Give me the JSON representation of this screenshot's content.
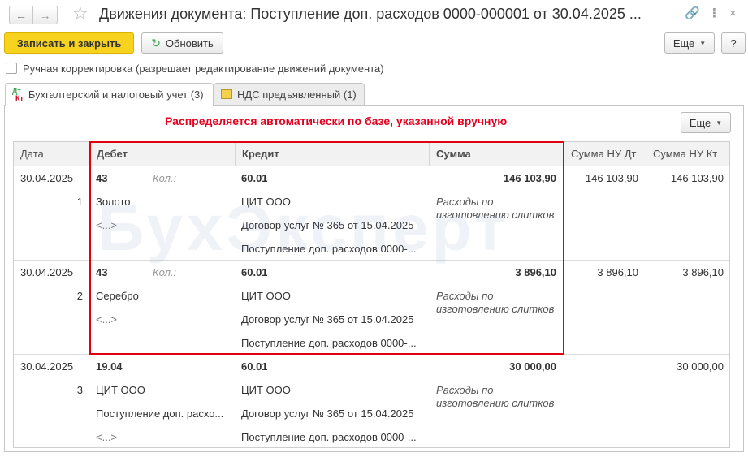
{
  "window": {
    "title": "Движения документа: Поступление доп. расходов 0000-000001 от 30.04.2025 ...",
    "nav_back": "←",
    "nav_forward": "→",
    "star": "☆",
    "link_icon": "🔗",
    "menu_icon": "⋮",
    "maximize_icon": "□",
    "close_icon": "×"
  },
  "toolbar": {
    "save_close_label": "Записать и закрыть",
    "refresh_icon": "↻",
    "refresh_label": "Обновить",
    "more_label": "Еще",
    "help_label": "?"
  },
  "manual_edit": {
    "label": "Ручная корректировка (разрешает редактирование движений документа)",
    "checked": false
  },
  "tabs": [
    {
      "label": "Бухгалтерский и налоговый учет (3)",
      "icon": "dt-kt-icon",
      "icon_top": "Дт",
      "icon_bottom": "Кт",
      "active": true
    },
    {
      "label": "НДС предъявленный (1)",
      "icon": "vat-register-icon",
      "active": false
    }
  ],
  "tab_more_label": "Еще",
  "banner": "Распределяется автоматически по базе, указанной вручную",
  "watermark": "БухЭксперт",
  "table": {
    "columns": [
      "Дата",
      "Дебет",
      "Кредит",
      "Сумма",
      "Сумма НУ Дт",
      "Сумма НУ Кт"
    ],
    "rows": [
      {
        "date": "30.04.2025",
        "num": "1",
        "debit_account": "43",
        "debit_qty_label": "Кол.:",
        "debit_sub1": "Золото",
        "debit_sub2": "<...>",
        "credit_account": "60.01",
        "credit_sub1": "ЦИТ ООО",
        "credit_sub2": "Договор услуг № 365 от 15.04.2025",
        "credit_sub3": "Поступление доп. расходов 0000-...",
        "amount": "146 103,90",
        "content": "Расходы по изготовлению слитков",
        "nu_dt": "146 103,90",
        "nu_kt": "146 103,90"
      },
      {
        "date": "30.04.2025",
        "num": "2",
        "debit_account": "43",
        "debit_qty_label": "Кол.:",
        "debit_sub1": "Серебро",
        "debit_sub2": "<...>",
        "credit_account": "60.01",
        "credit_sub1": "ЦИТ ООО",
        "credit_sub2": "Договор услуг № 365 от 15.04.2025",
        "credit_sub3": "Поступление доп. расходов 0000-...",
        "amount": "3 896,10",
        "content": "Расходы по изготовлению слитков",
        "nu_dt": "3 896,10",
        "nu_kt": "3 896,10"
      },
      {
        "date": "30.04.2025",
        "num": "3",
        "debit_account": "19.04",
        "debit_qty_label": "",
        "debit_sub1": "ЦИТ ООО",
        "debit_sub2": "Поступление доп. расхо...",
        "debit_sub3": "<...>",
        "credit_account": "60.01",
        "credit_sub1": "ЦИТ ООО",
        "credit_sub2": "Договор услуг № 365 от 15.04.2025",
        "credit_sub3": "Поступление доп. расходов 0000-...",
        "amount": "30 000,00",
        "content": "Расходы по изготовлению слитков",
        "nu_dt": "",
        "nu_kt": "30 000,00"
      }
    ]
  },
  "colors": {
    "primary_button": "#f7d31f",
    "banner_text": "#e5001f",
    "highlight_frame": "#e00012",
    "refresh_icon": "#3aa34a"
  }
}
